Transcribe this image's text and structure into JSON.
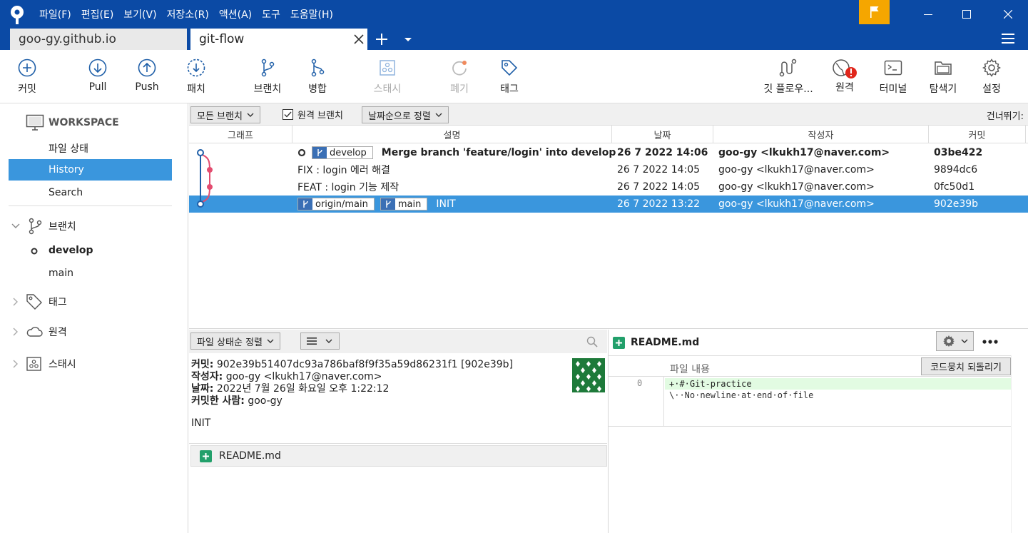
{
  "menu": [
    "파일(F)",
    "편집(E)",
    "보기(V)",
    "저장소(R)",
    "액션(A)",
    "도구",
    "도움말(H)"
  ],
  "tabs": [
    "goo-gy.github.io",
    "git-flow"
  ],
  "toolbar": {
    "commit": "커밋",
    "pull": "Pull",
    "push": "Push",
    "fetch": "패치",
    "branch": "브랜치",
    "merge": "병합",
    "stash": "스태시",
    "discard": "폐기",
    "tag": "태그",
    "gitflow": "깃 플로우...",
    "remote": "원격",
    "terminal": "터미널",
    "explorer": "탐색기",
    "settings": "설정"
  },
  "sidebar": {
    "workspace": "WORKSPACE",
    "items": [
      "파일 상태",
      "History",
      "Search"
    ],
    "branches_label": "브랜치",
    "branches": [
      "develop",
      "main"
    ],
    "tags_label": "태그",
    "remotes_label": "원격",
    "stashes_label": "스태시"
  },
  "filter": {
    "branches": "모든 브랜치",
    "remote_branches": "원격 브랜치",
    "sort": "날짜순으로 정렬",
    "skip": "건너뛰기:"
  },
  "columns": {
    "graph": "그래프",
    "description": "설명",
    "date": "날짜",
    "author": "작성자",
    "commit": "커밋"
  },
  "commits": [
    {
      "refs": [
        "develop"
      ],
      "message": "Merge branch 'feature/login' into develop",
      "date": "26 7 2022 14:06",
      "author": "goo-gy <lkukh17@naver.com>",
      "hash": "03be422"
    },
    {
      "refs": [],
      "message": "FIX : login 에러 해결",
      "date": "26 7 2022 14:05",
      "author": "goo-gy <lkukh17@naver.com>",
      "hash": "9894dc6"
    },
    {
      "refs": [],
      "message": "FEAT : login 기능 제작",
      "date": "26 7 2022 14:05",
      "author": "goo-gy <lkukh17@naver.com>",
      "hash": "0fc50d1"
    },
    {
      "refs": [
        "origin/main",
        "main"
      ],
      "message": "INIT",
      "date": "26 7 2022 13:22",
      "author": "goo-gy <lkukh17@naver.com>",
      "hash": "902e39b"
    }
  ],
  "detail_bar": {
    "sort": "파일 상태순 정렬"
  },
  "detail": {
    "commit_label": "커밋:",
    "commit_value": "902e39b51407dc93a786baf8f9f35a59d86231f1 [902e39b]",
    "author_label": "작성자:",
    "author_value": "goo-gy <lkukh17@naver.com>",
    "date_label": "날짜:",
    "date_value": "2022년 7월 26일 화요일 오후 1:22:12",
    "committer_label": "커밋한 사람:",
    "committer_value": "goo-gy",
    "message": "INIT"
  },
  "files": [
    "README.md"
  ],
  "diff": {
    "filename": "README.md",
    "hunk_label": "파일 내용",
    "revert": "코드뭉치 되돌리기",
    "line_no": "0",
    "lines": [
      "+·#·Git-practice",
      "\\··No·newline·at·end·of·file"
    ]
  },
  "colors": {
    "accent": "#0b4aa5",
    "selected": "#3a96dd",
    "added": "#22a06b",
    "graph_blue": "#1f5fa8",
    "graph_pink": "#e34c6f"
  }
}
